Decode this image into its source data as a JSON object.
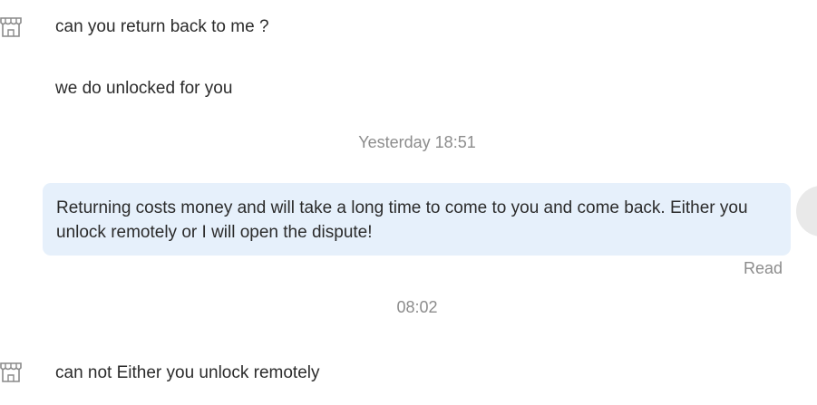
{
  "conversation": {
    "messages": [
      {
        "sender": "seller",
        "icon": "store-icon",
        "text": "can you return back to me ?"
      },
      {
        "sender": "seller",
        "text": "we do unlocked for you"
      },
      {
        "sender": "me",
        "text": "Returning costs money and will take a long time to come to you and come back. Either you unlock remotely or I will open the dispute!",
        "status": "Read"
      },
      {
        "sender": "seller",
        "icon": "store-icon",
        "text": "can not Either you unlock remotely"
      }
    ],
    "timestamps": [
      "Yesterday 18:51",
      "08:02"
    ]
  },
  "colors": {
    "bubble_background": "#e6f0fb",
    "text": "#2b2b2b",
    "muted_text": "#8c8c8c",
    "icon_stroke": "#8a8a8a"
  }
}
